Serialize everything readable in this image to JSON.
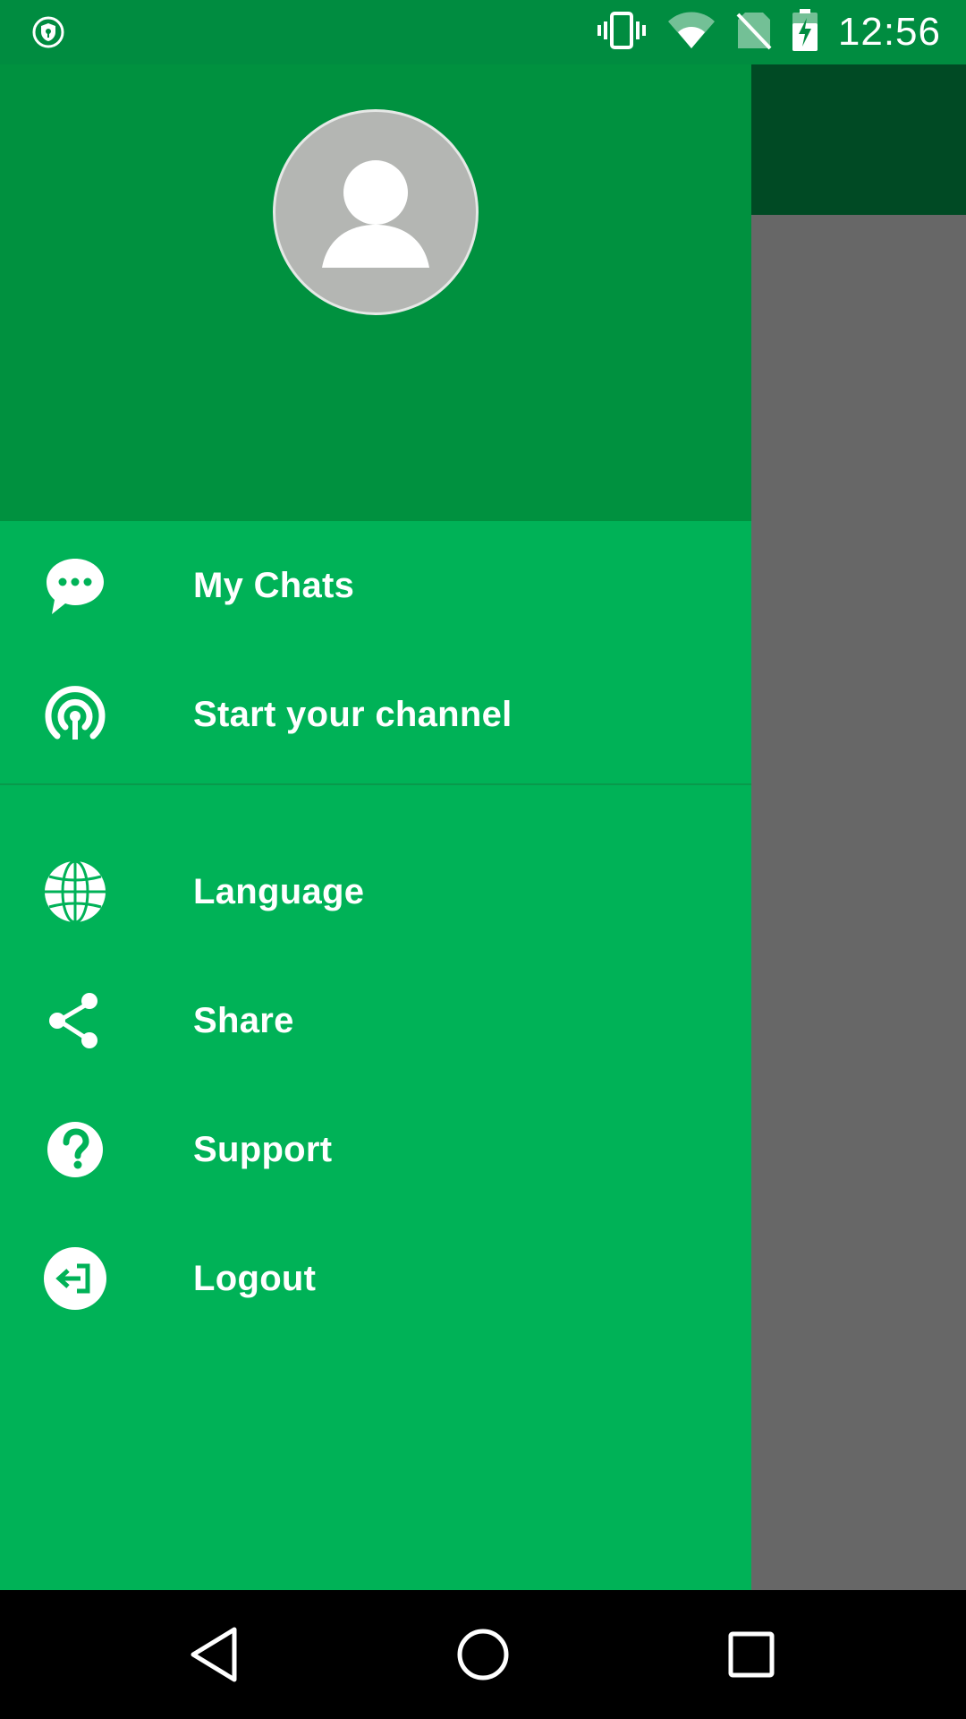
{
  "status_bar": {
    "time": "12:56",
    "icons": [
      "shield-icon",
      "vibrate-icon",
      "wifi-icon",
      "no-sim-icon",
      "battery-charging-icon"
    ]
  },
  "drawer": {
    "header": {
      "avatar_icon": "person-icon"
    },
    "items_primary": [
      {
        "label": "My Chats",
        "icon": "chat-bubble-icon"
      },
      {
        "label": "Start your channel",
        "icon": "broadcast-icon"
      }
    ],
    "items_secondary": [
      {
        "label": "Language",
        "icon": "globe-icon"
      },
      {
        "label": "Share",
        "icon": "share-icon"
      },
      {
        "label": "Support",
        "icon": "help-icon"
      },
      {
        "label": "Logout",
        "icon": "logout-icon"
      }
    ]
  },
  "nav_bar": {
    "buttons": [
      "back-icon",
      "home-icon",
      "recents-icon"
    ]
  },
  "colors": {
    "status_bar": "#008c40",
    "drawer_header": "#00913f",
    "drawer_body": "#00b257",
    "scrim": "#676767",
    "app_bar_dimmed": "#004a24"
  }
}
